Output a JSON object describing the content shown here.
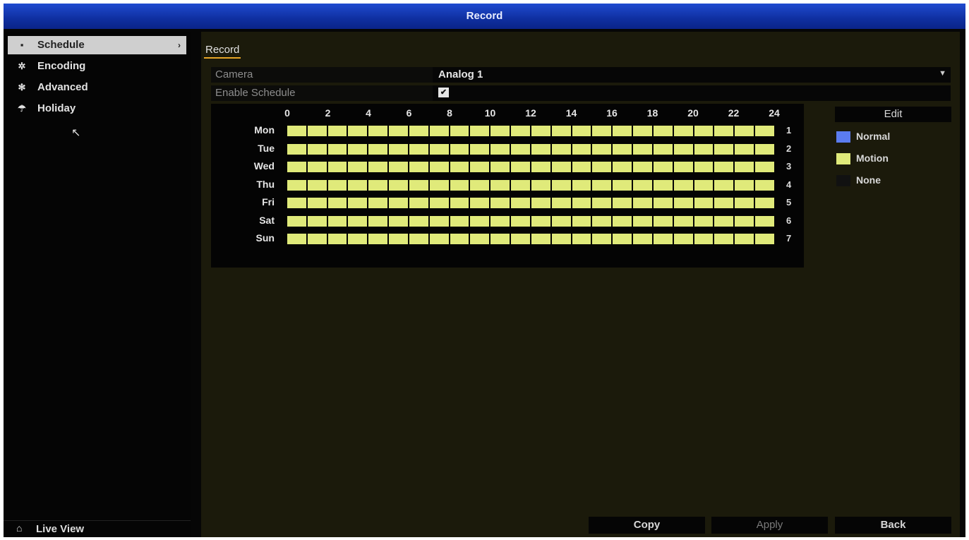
{
  "window": {
    "title": "Record"
  },
  "sidebar": {
    "items": [
      {
        "label": "Schedule",
        "icon": "list-icon",
        "glyph": "▪",
        "active": true,
        "chevron": "›"
      },
      {
        "label": "Encoding",
        "icon": "gear-icon",
        "glyph": "✲",
        "active": false
      },
      {
        "label": "Advanced",
        "icon": "cogs-icon",
        "glyph": "✻",
        "active": false
      },
      {
        "label": "Holiday",
        "icon": "umbrella-icon",
        "glyph": "☂",
        "active": false
      }
    ],
    "live_view": {
      "label": "Live View",
      "icon": "home-icon",
      "glyph": "⌂"
    }
  },
  "main": {
    "tab": "Record",
    "camera": {
      "label": "Camera",
      "value": "Analog 1"
    },
    "enable_schedule": {
      "label": "Enable Schedule",
      "checked": true,
      "glyph": "✔"
    },
    "schedule": {
      "hours": [
        "0",
        "2",
        "4",
        "6",
        "8",
        "10",
        "12",
        "14",
        "16",
        "18",
        "20",
        "22",
        "24"
      ],
      "days": [
        {
          "label": "Mon",
          "num": "1"
        },
        {
          "label": "Tue",
          "num": "2"
        },
        {
          "label": "Wed",
          "num": "3"
        },
        {
          "label": "Thu",
          "num": "4"
        },
        {
          "label": "Fri",
          "num": "5"
        },
        {
          "label": "Sat",
          "num": "6"
        },
        {
          "label": "Sun",
          "num": "7"
        }
      ]
    },
    "edit_label": "Edit",
    "legend": [
      {
        "label": "Normal",
        "color": "#5b7cf0"
      },
      {
        "label": "Motion",
        "color": "#e0ea7a"
      },
      {
        "label": "None",
        "color": "#111111"
      }
    ],
    "buttons": {
      "copy": "Copy",
      "apply": "Apply",
      "back": "Back"
    }
  },
  "colors": {
    "title_bar": "#1f4bd0",
    "motion": "#e0ea7a",
    "tab_underline": "#e6a628"
  }
}
